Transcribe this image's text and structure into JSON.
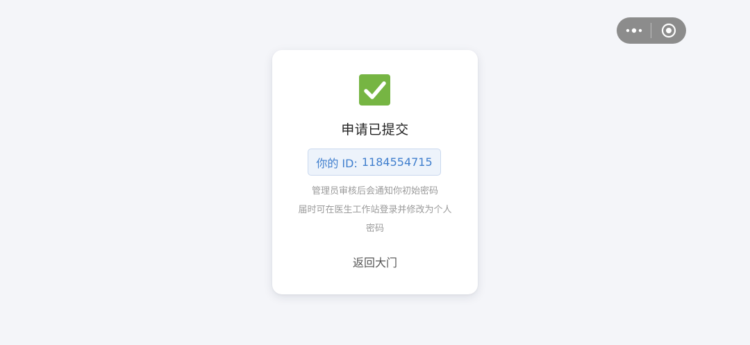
{
  "capsule": {
    "more_icon": "more-dots-icon",
    "close_icon": "target-circle-icon"
  },
  "card": {
    "status_icon": "check-mark-icon",
    "title": "申请已提交",
    "id_label": "你的 ID:",
    "id_value": "1184554715",
    "note_line_1": "管理员审核后会通知你初始密码",
    "note_line_2": "届时可在医生工作站登录并修改为个人",
    "note_line_3": "密码",
    "back_link": "返回大门"
  },
  "colors": {
    "page_background": "#f4f5f9",
    "check_green": "#76b543",
    "id_text_blue": "#3f7ecd",
    "id_box_background": "#edf3fb"
  }
}
